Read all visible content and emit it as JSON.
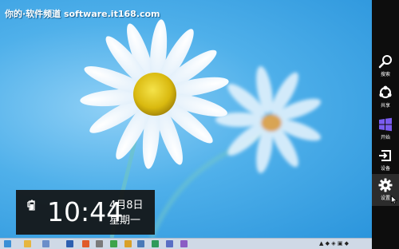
{
  "watermark": "你的·软件频道 software.it168.com",
  "clock": {
    "time": "10:44",
    "date": "4月8日",
    "weekday": "星期一"
  },
  "charms": [
    {
      "label": "搜索",
      "icon": "search-icon"
    },
    {
      "label": "共享",
      "icon": "share-icon"
    },
    {
      "label": "开始",
      "icon": "windows-logo-icon"
    },
    {
      "label": "设备",
      "icon": "devices-icon"
    },
    {
      "label": "设置",
      "icon": "settings-gear-icon",
      "active": true
    }
  ],
  "colors": {
    "sky": "#4fb0ea",
    "charm_bar": "#0d0d0d",
    "windows_logo": "#7a5cf0",
    "clock_panel": "#121212"
  }
}
